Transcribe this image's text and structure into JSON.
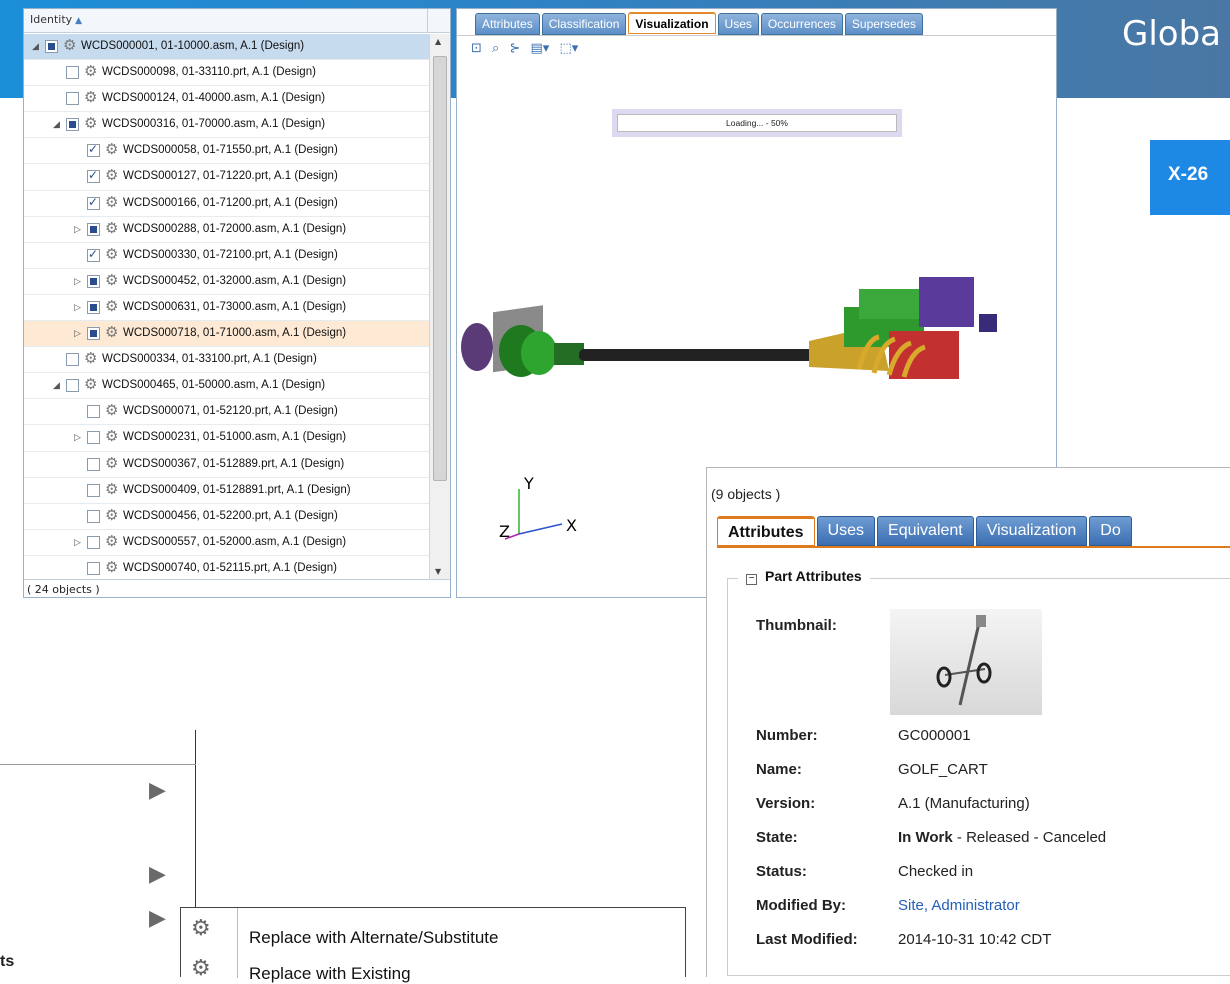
{
  "banner": {
    "title": "Globa",
    "badge": "X-26"
  },
  "tree": {
    "header": "Identity",
    "footer": "( 24 objects )",
    "rows": [
      {
        "label": "WCDS000001, 01-10000.asm, A.1 (Design)",
        "level": 0,
        "expander": "◢",
        "check": "part",
        "state": "sel"
      },
      {
        "label": "WCDS000098, 01-33110.prt, A.1 (Design)",
        "level": 1,
        "expander": "",
        "check": "none",
        "state": ""
      },
      {
        "label": "WCDS000124, 01-40000.asm, A.1 (Design)",
        "level": 1,
        "expander": "",
        "check": "none",
        "state": ""
      },
      {
        "label": "WCDS000316, 01-70000.asm, A.1 (Design)",
        "level": 1,
        "expander": "◢",
        "check": "part",
        "state": ""
      },
      {
        "label": "WCDS000058, 01-71550.prt, A.1 (Design)",
        "level": 2,
        "expander": "",
        "check": "chk",
        "state": ""
      },
      {
        "label": "WCDS000127, 01-71220.prt, A.1 (Design)",
        "level": 2,
        "expander": "",
        "check": "chk",
        "state": ""
      },
      {
        "label": "WCDS000166, 01-71200.prt, A.1 (Design)",
        "level": 2,
        "expander": "",
        "check": "chk",
        "state": ""
      },
      {
        "label": "WCDS000288, 01-72000.asm, A.1 (Design)",
        "level": 2,
        "expander": "▷",
        "check": "part",
        "state": ""
      },
      {
        "label": "WCDS000330, 01-72100.prt, A.1 (Design)",
        "level": 2,
        "expander": "",
        "check": "chk",
        "state": ""
      },
      {
        "label": "WCDS000452, 01-32000.asm, A.1 (Design)",
        "level": 2,
        "expander": "▷",
        "check": "part",
        "state": ""
      },
      {
        "label": "WCDS000631, 01-73000.asm, A.1 (Design)",
        "level": 2,
        "expander": "▷",
        "check": "part",
        "state": ""
      },
      {
        "label": "WCDS000718, 01-71000.asm, A.1 (Design)",
        "level": 2,
        "expander": "▷",
        "check": "part",
        "state": "hl"
      },
      {
        "label": "WCDS000334, 01-33100.prt, A.1 (Design)",
        "level": 1,
        "expander": "",
        "check": "none",
        "state": ""
      },
      {
        "label": "WCDS000465, 01-50000.asm, A.1 (Design)",
        "level": 1,
        "expander": "◢",
        "check": "none",
        "state": ""
      },
      {
        "label": "WCDS000071, 01-52120.prt, A.1 (Design)",
        "level": 2,
        "expander": "",
        "check": "none",
        "state": ""
      },
      {
        "label": "WCDS000231, 01-51000.asm, A.1 (Design)",
        "level": 2,
        "expander": "▷",
        "check": "none",
        "state": ""
      },
      {
        "label": "WCDS000367, 01-512889.prt, A.1 (Design)",
        "level": 2,
        "expander": "",
        "check": "none",
        "state": ""
      },
      {
        "label": "WCDS000409, 01-5128891.prt, A.1 (Design)",
        "level": 2,
        "expander": "",
        "check": "none",
        "state": ""
      },
      {
        "label": "WCDS000456, 01-52200.prt, A.1 (Design)",
        "level": 2,
        "expander": "",
        "check": "none",
        "state": ""
      },
      {
        "label": "WCDS000557, 01-52000.asm, A.1 (Design)",
        "level": 2,
        "expander": "▷",
        "check": "none",
        "state": ""
      },
      {
        "label": "WCDS000740, 01-52115.prt, A.1 (Design)",
        "level": 2,
        "expander": "",
        "check": "none",
        "state": ""
      }
    ]
  },
  "viewer": {
    "tabs": [
      "Attributes",
      "Classification",
      "Visualization",
      "Uses",
      "Occurrences",
      "Supersedes"
    ],
    "active_tab": 2,
    "loading_text": "Loading... - 50%",
    "loading_progress_percent": 50,
    "axes": {
      "x": "X",
      "y": "Y",
      "z": "Z"
    }
  },
  "attributes": {
    "count": "(9 objects )",
    "tabs": [
      "Attributes",
      "Uses",
      "Equivalent",
      "Visualization",
      "Do"
    ],
    "active_tab": 0,
    "section_title": "Part Attributes",
    "thumbnail_label": "Thumbnail:",
    "fields": [
      {
        "key": "Number:",
        "value": "GC000001"
      },
      {
        "key": "Name:",
        "value": "GOLF_CART"
      },
      {
        "key": "Version:",
        "value": "A.1 (Manufacturing)"
      },
      {
        "key": "State:",
        "value_bold": "In Work",
        "value": " - Released - Canceled"
      },
      {
        "key": "Status:",
        "value": "Checked in"
      },
      {
        "key": "Modified By:",
        "value": "Site, Administrator",
        "link": true
      },
      {
        "key": "Last Modified:",
        "value": "2014-10-31 10:42 CDT"
      }
    ]
  },
  "menu": {
    "partial_label": "ts",
    "submenu_items": [
      "Replace with Alternate/Substitute",
      "Replace with Existing"
    ]
  }
}
